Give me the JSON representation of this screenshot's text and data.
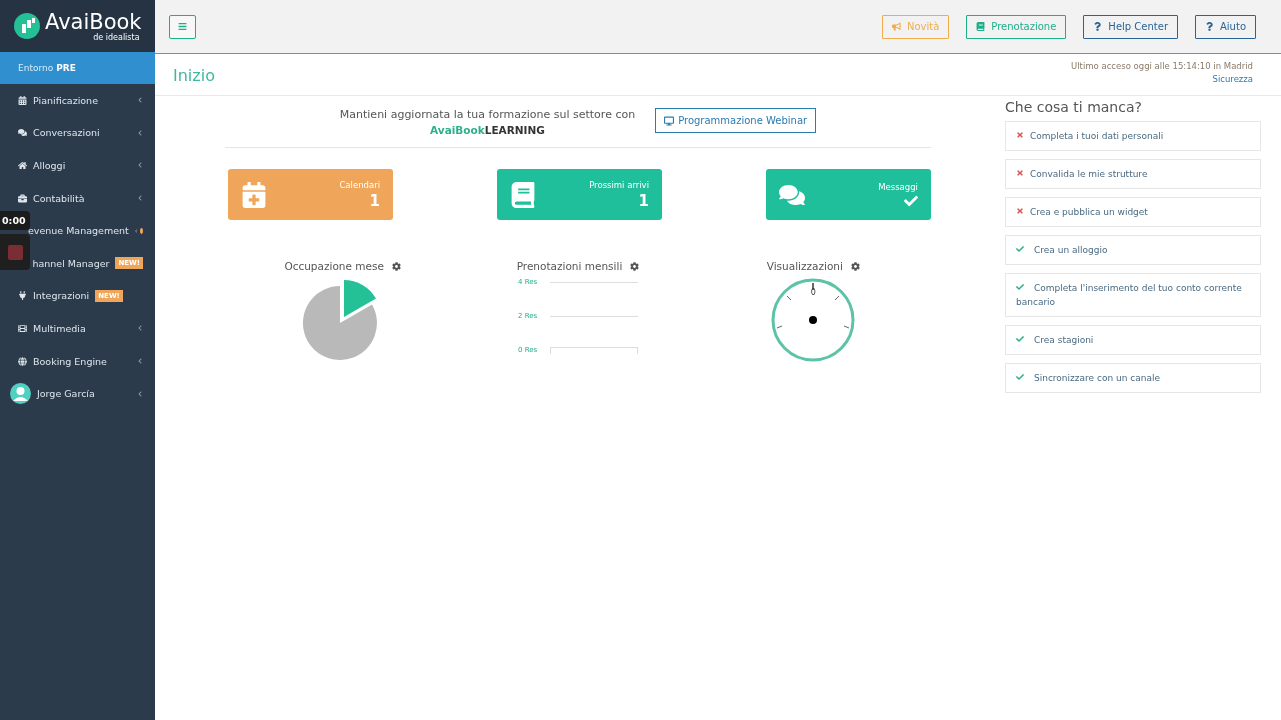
{
  "logo": {
    "name": "AvaiBook",
    "sub": "de",
    "brand": "idealista"
  },
  "environment": {
    "label": "Entorno",
    "value": "PRE"
  },
  "sidebar": {
    "items": [
      {
        "label": "Pianificazione",
        "chevron": true,
        "dot": false
      },
      {
        "label": "Conversazioni",
        "chevron": true,
        "dot": false
      },
      {
        "label": "Alloggi",
        "chevron": true,
        "dot": false
      },
      {
        "label": "Contabilità",
        "chevron": true,
        "dot": false
      },
      {
        "label": "evenue Management",
        "chevron": true,
        "dot": true
      },
      {
        "label": "hannel Manager",
        "chevron": false,
        "badge": "NEW!",
        "dot": false
      },
      {
        "label": "Integrazioni",
        "chevron": false,
        "badge": "NEW!",
        "dot": false
      },
      {
        "label": "Multimedia",
        "chevron": true,
        "dot": false
      },
      {
        "label": "Booking Engine",
        "chevron": true,
        "dot": false
      }
    ],
    "user": {
      "name": "Jorge García",
      "chevron": true
    }
  },
  "recorder": {
    "time": "0:00"
  },
  "topbar": {
    "buttons": [
      {
        "label": "Novità",
        "color": "#f0ad4e"
      },
      {
        "label": "Prenotazione",
        "color": "#1fae8c"
      },
      {
        "label": "Help Center",
        "color": "#2a6496"
      },
      {
        "label": "Aiuto",
        "color": "#2a6496"
      }
    ]
  },
  "page": {
    "title": "Inizio",
    "last_access": "Ultimo acceso oggi alle 15:14:10 in Madrid",
    "security_link": "Sicurezza"
  },
  "learning": {
    "text": "Mantieni aggiornata la tua formazione sul settore con",
    "brand": "AvaiBook",
    "brand_suffix": "LEARNING",
    "button": "Programmazione Webinar"
  },
  "cards": [
    {
      "label": "Calendari",
      "value": "1",
      "color": "#f0a65a"
    },
    {
      "label": "Prossimi arrivi",
      "value": "1",
      "color": "#1fbf9c"
    },
    {
      "label": "Messaggi",
      "color": "#1fbf9c"
    }
  ],
  "widgets": [
    {
      "title": "Occupazione mese",
      "kind": "pie"
    },
    {
      "title": "Prenotazioni mensili",
      "kind": "lines",
      "labels": [
        "4 Res",
        "2 Res",
        "0 Res"
      ]
    },
    {
      "title": "Visualizzazioni",
      "kind": "gauge",
      "reading": "0"
    }
  ],
  "checklist": {
    "title": "Che cosa ti manca?",
    "items": [
      {
        "label": "Completa i tuoi dati personali",
        "done": false
      },
      {
        "label": "Convalida le mie strutture",
        "done": false
      },
      {
        "label": "Crea e pubblica un widget",
        "done": false
      },
      {
        "label": "Crea un alloggio",
        "done": true
      },
      {
        "label": "Completa l'inserimento del tuo conto corrente bancario",
        "done": true
      },
      {
        "label": "Crea stagioni",
        "done": true
      },
      {
        "label": "Sincronizzare con un canale",
        "done": true
      }
    ]
  }
}
